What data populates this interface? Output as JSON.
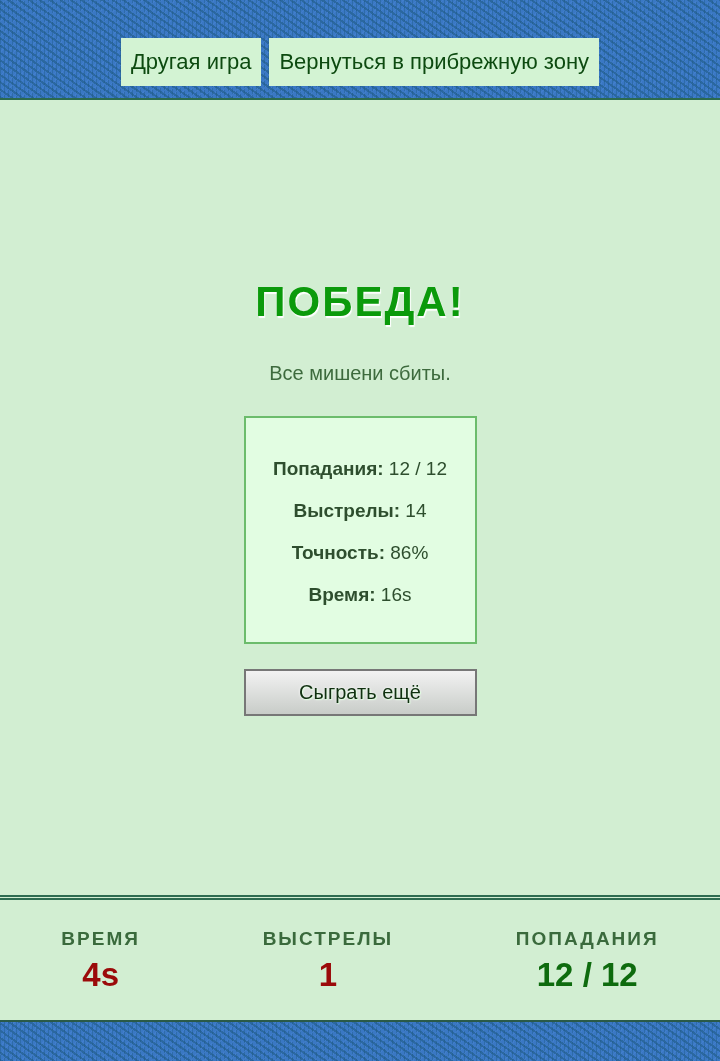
{
  "nav_buttons": [
    {
      "label": "Другая игра"
    },
    {
      "label": "Вернуться в прибрежную зону"
    }
  ],
  "result": {
    "title": "ПОБЕДА!",
    "message": "Все мишени сбиты.",
    "summary": [
      "**Попадания:** 12 / 12",
      "**Выстрелы:** 14",
      "**Точность:** 86%",
      "**Время:** 16s"
    ],
    "button": "Сыграть ещё"
  },
  "stats_bar": [
    {
      "label": "ВРЕМЯ",
      "value": "4s",
      "color": "#9b0a0a"
    },
    {
      "label": "ВЫСТРЕЛЫ",
      "value": "1",
      "color": "#9b0a0a"
    },
    {
      "label": "ПОПАДАНИЯ",
      "value": "12 / 12",
      "color": "#0e6b0e"
    }
  ]
}
